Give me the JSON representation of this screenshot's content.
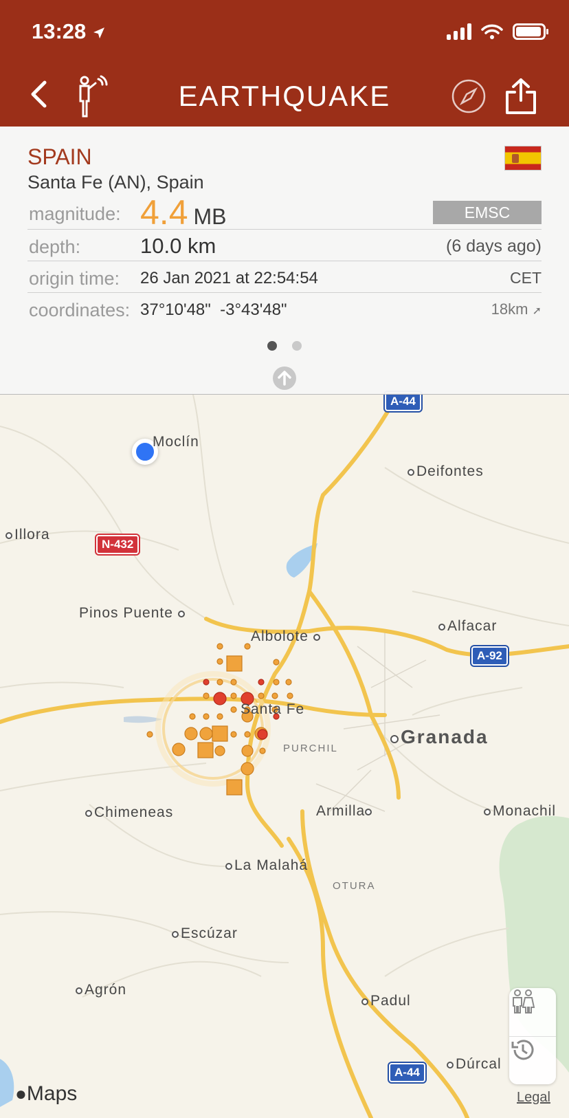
{
  "status_bar": {
    "time": "13:28"
  },
  "nav": {
    "title": "EARTHQUAKE"
  },
  "event": {
    "country": "SPAIN",
    "place": "Santa Fe (AN), Spain",
    "magnitude_label": "magnitude:",
    "magnitude_value": "4.4",
    "magnitude_unit": "MB",
    "source": "EMSC",
    "depth_label": "depth:",
    "depth_value": "10.0 km",
    "age": "(6 days ago)",
    "origin_label": "origin time:",
    "origin_value": "26 Jan 2021 at 22:54:54",
    "timezone": "CET",
    "coords_label": "coordinates:",
    "coords_value": "37°10'48\"  -3°43'48\"",
    "distance": "18km"
  },
  "map": {
    "towns": {
      "moclin": "Moclín",
      "deifontes": "Deifontes",
      "illora": "Illora",
      "pinos_puente": "Pinos Puente",
      "albolote": "Albolote",
      "alfacar": "Alfacar",
      "santa_fe": "Santa Fe",
      "granada": "Granada",
      "purchil": "PURCHIL",
      "chimeneas": "Chimeneas",
      "armilla": "Armilla",
      "monachil": "Monachil",
      "la_malaha": "La Malahá",
      "otura": "OTURA",
      "escuzar": "Escúzar",
      "agron": "Agrón",
      "padul": "Padul",
      "durcal": "Dúrcal"
    },
    "roads": {
      "a44_top": "A-44",
      "n432": "N-432",
      "a92": "A-92",
      "a44_bottom": "A-44"
    },
    "attribution": "Maps",
    "legal": "Legal"
  },
  "colors": {
    "header": "#9b2f18",
    "accent": "#f0a039",
    "quake_orange": "#f0a33c",
    "quake_red": "#e0402e"
  }
}
